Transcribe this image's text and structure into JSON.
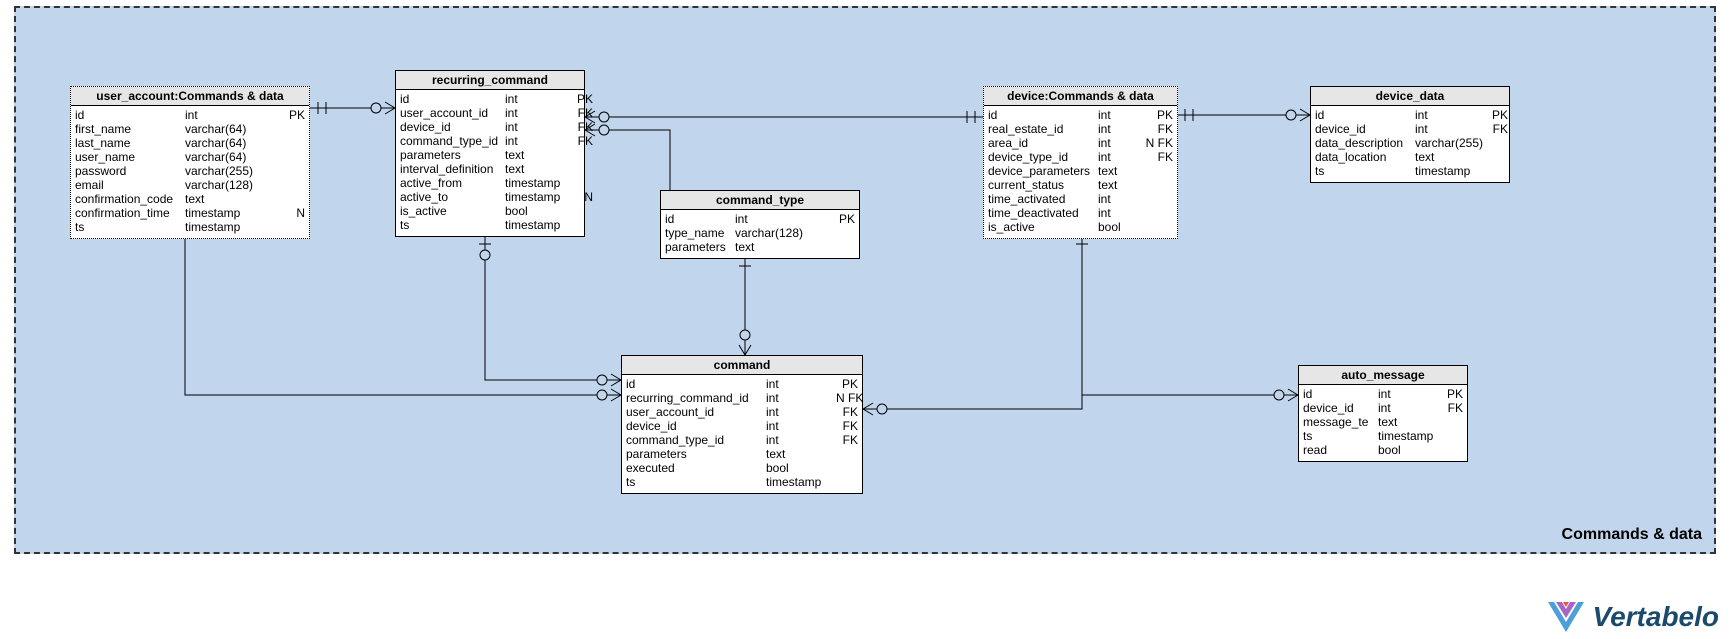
{
  "area": {
    "label": "Commands & data"
  },
  "entities": {
    "user_account": {
      "title": "user_account:Commands & data",
      "rows": [
        {
          "name": "id",
          "type": "int",
          "key": "PK"
        },
        {
          "name": "first_name",
          "type": "varchar(64)",
          "key": ""
        },
        {
          "name": "last_name",
          "type": "varchar(64)",
          "key": ""
        },
        {
          "name": "user_name",
          "type": "varchar(64)",
          "key": ""
        },
        {
          "name": "password",
          "type": "varchar(255)",
          "key": ""
        },
        {
          "name": "email",
          "type": "varchar(128)",
          "key": ""
        },
        {
          "name": "confirmation_code",
          "type": "text",
          "key": ""
        },
        {
          "name": "confirmation_time",
          "type": "timestamp",
          "key": "N"
        },
        {
          "name": "ts",
          "type": "timestamp",
          "key": ""
        }
      ]
    },
    "recurring_command": {
      "title": "recurring_command",
      "rows": [
        {
          "name": "id",
          "type": "int",
          "key": "PK"
        },
        {
          "name": "user_account_id",
          "type": "int",
          "key": "FK"
        },
        {
          "name": "device_id",
          "type": "int",
          "key": "FK"
        },
        {
          "name": "command_type_id",
          "type": "int",
          "key": "FK"
        },
        {
          "name": "parameters",
          "type": "text",
          "key": ""
        },
        {
          "name": "interval_definition",
          "type": "text",
          "key": ""
        },
        {
          "name": "active_from",
          "type": "timestamp",
          "key": ""
        },
        {
          "name": "active_to",
          "type": "timestamp",
          "key": "N"
        },
        {
          "name": "is_active",
          "type": "bool",
          "key": ""
        },
        {
          "name": "ts",
          "type": "timestamp",
          "key": ""
        }
      ]
    },
    "command_type": {
      "title": "command_type",
      "rows": [
        {
          "name": "id",
          "type": "int",
          "key": "PK"
        },
        {
          "name": "type_name",
          "type": "varchar(128)",
          "key": ""
        },
        {
          "name": "parameters",
          "type": "text",
          "key": ""
        }
      ]
    },
    "device": {
      "title": "device:Commands & data",
      "rows": [
        {
          "name": "id",
          "type": "int",
          "key": "PK"
        },
        {
          "name": "real_estate_id",
          "type": "int",
          "key": "FK"
        },
        {
          "name": "area_id",
          "type": "int",
          "key": "N FK"
        },
        {
          "name": "device_type_id",
          "type": "int",
          "key": "FK"
        },
        {
          "name": "device_parameters",
          "type": "text",
          "key": ""
        },
        {
          "name": "current_status",
          "type": "text",
          "key": ""
        },
        {
          "name": "time_activated",
          "type": "int",
          "key": ""
        },
        {
          "name": "time_deactivated",
          "type": "int",
          "key": ""
        },
        {
          "name": "is_active",
          "type": "bool",
          "key": ""
        }
      ]
    },
    "device_data": {
      "title": "device_data",
      "rows": [
        {
          "name": "id",
          "type": "int",
          "key": "PK"
        },
        {
          "name": "device_id",
          "type": "int",
          "key": "FK"
        },
        {
          "name": "data_description",
          "type": "varchar(255)",
          "key": ""
        },
        {
          "name": "data_location",
          "type": "text",
          "key": ""
        },
        {
          "name": "ts",
          "type": "timestamp",
          "key": ""
        }
      ]
    },
    "command": {
      "title": "command",
      "rows": [
        {
          "name": "id",
          "type": "int",
          "key": "PK"
        },
        {
          "name": "recurring_command_id",
          "type": "int",
          "key": "N FK"
        },
        {
          "name": "user_account_id",
          "type": "int",
          "key": "FK"
        },
        {
          "name": "device_id",
          "type": "int",
          "key": "FK"
        },
        {
          "name": "command_type_id",
          "type": "int",
          "key": "FK"
        },
        {
          "name": "parameters",
          "type": "text",
          "key": ""
        },
        {
          "name": "executed",
          "type": "bool",
          "key": ""
        },
        {
          "name": "ts",
          "type": "timestamp",
          "key": ""
        }
      ]
    },
    "auto_message": {
      "title": "auto_message",
      "rows": [
        {
          "name": "id",
          "type": "int",
          "key": "PK"
        },
        {
          "name": "device_id",
          "type": "int",
          "key": "FK"
        },
        {
          "name": "message_te",
          "type": "text",
          "key": ""
        },
        {
          "name": "ts",
          "type": "timestamp",
          "key": ""
        },
        {
          "name": "read",
          "type": "bool",
          "key": ""
        }
      ]
    }
  },
  "logo": {
    "text": "Vertabelo"
  }
}
